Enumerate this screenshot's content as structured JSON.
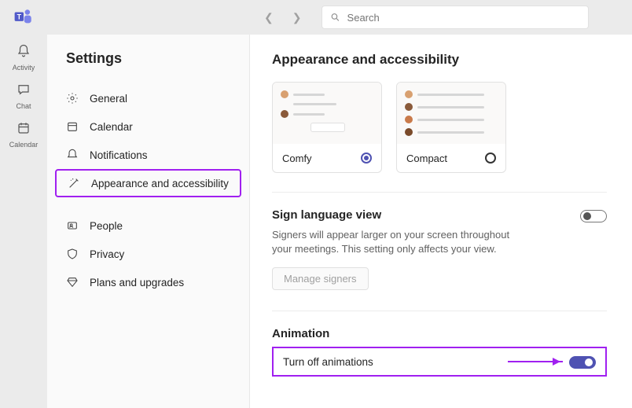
{
  "rail": {
    "items": [
      {
        "label": "Activity"
      },
      {
        "label": "Chat"
      },
      {
        "label": "Calendar"
      }
    ]
  },
  "topbar": {
    "search_placeholder": "Search"
  },
  "settings": {
    "title": "Settings",
    "nav1": [
      {
        "label": "General"
      },
      {
        "label": "Calendar"
      },
      {
        "label": "Notifications"
      },
      {
        "label": "Appearance and accessibility"
      }
    ],
    "nav2": [
      {
        "label": "People"
      },
      {
        "label": "Privacy"
      },
      {
        "label": "Plans and upgrades"
      }
    ]
  },
  "pane": {
    "heading": "Appearance and accessibility",
    "density": {
      "comfy": "Comfy",
      "compact": "Compact"
    },
    "sign": {
      "title": "Sign language view",
      "desc": "Signers will appear larger on your screen throughout your meetings. This setting only affects your view.",
      "btn": "Manage signers"
    },
    "anim": {
      "title": "Animation",
      "label": "Turn off animations"
    }
  }
}
